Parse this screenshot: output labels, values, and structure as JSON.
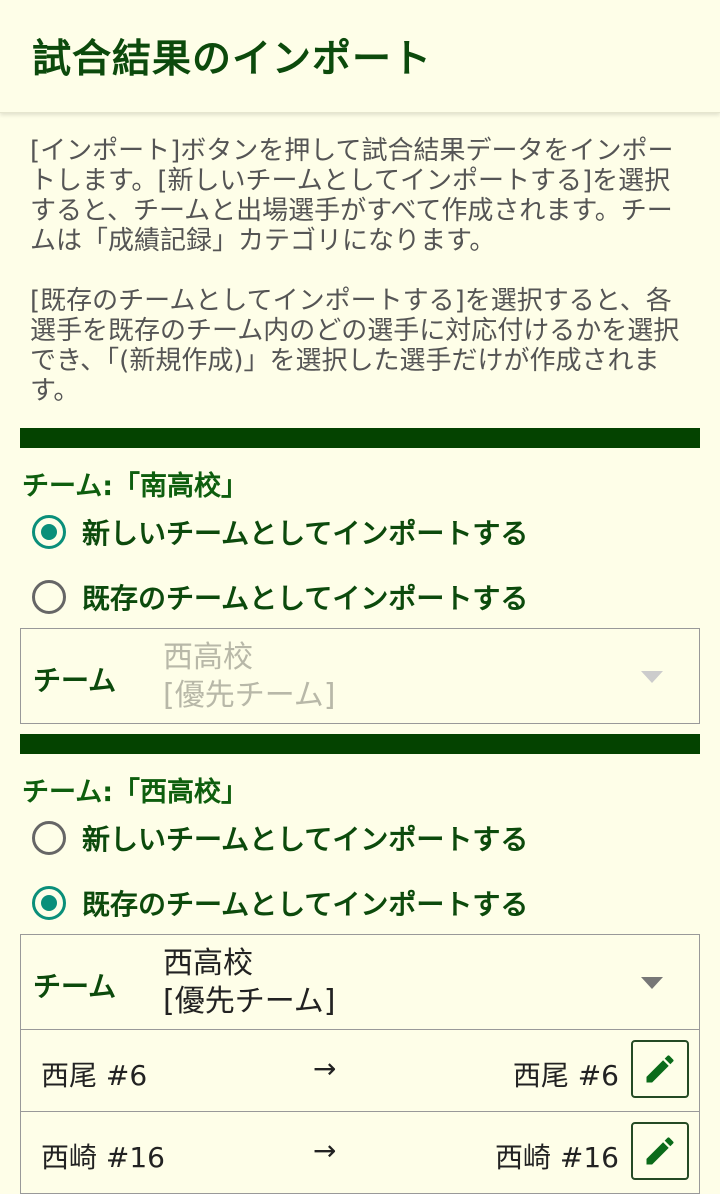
{
  "header": {
    "title": "試合結果のインポート"
  },
  "description": {
    "paragraph1": "[インポート]ボタンを押して試合結果データをインポートします。[新しいチームとしてインポートする]を選択すると、チームと出場選手がすべて作成されます。チームは「成績記録」カテゴリになります。",
    "paragraph2": "[既存のチームとしてインポートする]を選択すると、各選手を既存のチーム内のどの選手に対応付けるかを選択でき、「(新規作成)」を選択した選手だけが作成されます。"
  },
  "teams": [
    {
      "heading": "チーム:「南高校」",
      "option_new": "新しいチームとしてインポートする",
      "option_existing": "既存のチームとしてインポートする",
      "selected": "new",
      "select_label": "チーム",
      "select_value_line1": "西高校",
      "select_value_line2": "[優先チーム]",
      "select_disabled": true
    },
    {
      "heading": "チーム:「西高校」",
      "option_new": "新しいチームとしてインポートする",
      "option_existing": "既存のチームとしてインポートする",
      "selected": "existing",
      "select_label": "チーム",
      "select_value_line1": "西高校",
      "select_value_line2": "[優先チーム]",
      "select_disabled": false,
      "players": [
        {
          "source": "西尾  #6",
          "arrow": "→",
          "target": "西尾  #6"
        },
        {
          "source": "西崎  #16",
          "arrow": "→",
          "target": "西崎  #16"
        }
      ]
    }
  ],
  "colors": {
    "background": "#fefee8",
    "primary_green": "#0c4a0c",
    "divider_green": "#044300",
    "radio_accent": "#0a8f7a"
  },
  "icons": {
    "edit": "pencil-icon",
    "dropdown": "chevron-down-icon"
  }
}
